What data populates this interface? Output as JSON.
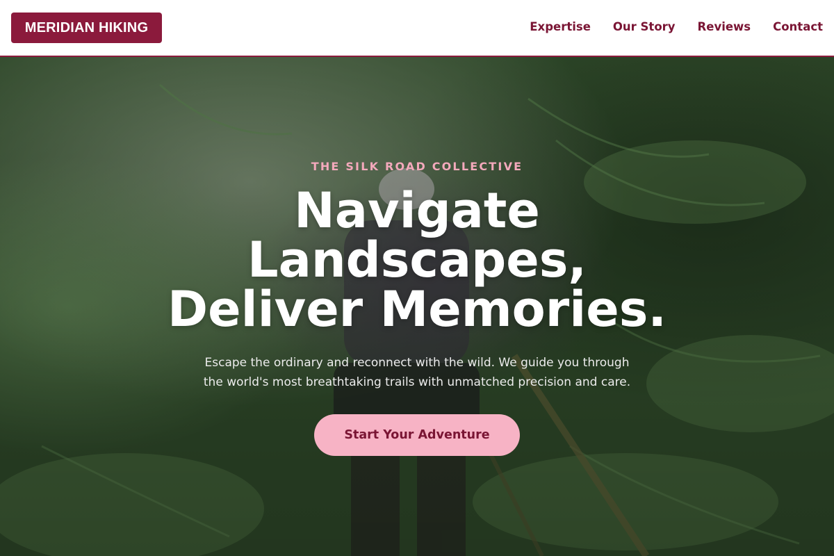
{
  "header": {
    "logo": "MERIDIAN HIKING",
    "nav": [
      "Expertise",
      "Our Story",
      "Reviews",
      "Contact"
    ]
  },
  "hero": {
    "eyebrow": "THE SILK ROAD COLLECTIVE",
    "headline_lines": [
      "Navigate",
      "Landscapes,",
      "Deliver Memories."
    ],
    "subtext_lines": [
      "Escape the ordinary and reconnect with the wild. We guide you through",
      "the world's most breathtaking trails with unmatched precision and care."
    ],
    "cta": "Start Your Adventure",
    "background": "forest-fern-trail-hiker-photo"
  },
  "colors": {
    "brand": "#8b1a3c",
    "nav_text": "#7a1534",
    "eyebrow": "#f4a9bc",
    "cta_bg": "#f7b3c5",
    "cta_text": "#7a1534",
    "foliage": "#2f4a2b"
  }
}
